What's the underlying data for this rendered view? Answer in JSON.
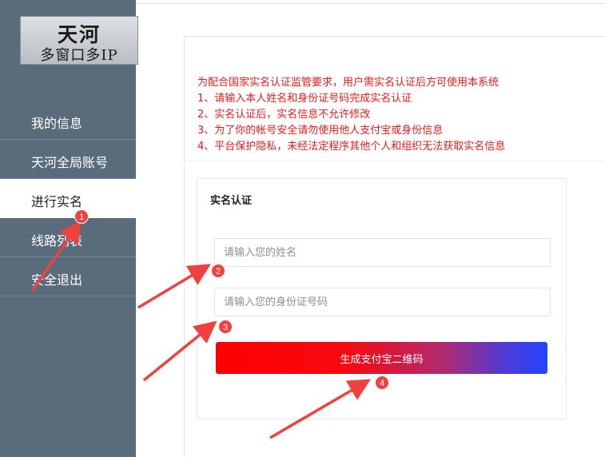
{
  "logo": {
    "title": "天河",
    "subtitle": "多窗口多IP"
  },
  "sidebar": {
    "items": [
      {
        "label": "我的信息"
      },
      {
        "label": "天河全局账号"
      },
      {
        "label": "进行实名"
      },
      {
        "label": "线路列表"
      },
      {
        "label": "安全退出"
      }
    ],
    "active_index": 2
  },
  "notice": {
    "lines": [
      "为配合国家实名认证监管要求，用户需实名认证后方可使用本系统",
      "1、请输入本人姓名和身份证号码完成实名认证",
      "2、实名认证后，实名信息不允许修改",
      "3、为了你的帐号安全请勿使用他人支付宝或身份信息",
      "4、平台保护隐私，未经法定程序其他个人和组织无法获取实名信息"
    ]
  },
  "form": {
    "title": "实名认证",
    "name_value": "",
    "name_placeholder": "请输入您的姓名",
    "id_value": "",
    "id_placeholder": "请输入您的身份证号码",
    "submit_label": "生成支付宝二维码"
  },
  "annotations": {
    "badges": [
      "1",
      "2",
      "3",
      "4"
    ],
    "color": "#f0413f"
  },
  "colors": {
    "sidebar_bg": "#5a6b7c",
    "notice_text": "#e21b1b",
    "button_gradient_start": "#ff0000",
    "button_gradient_end": "#2345ff"
  }
}
